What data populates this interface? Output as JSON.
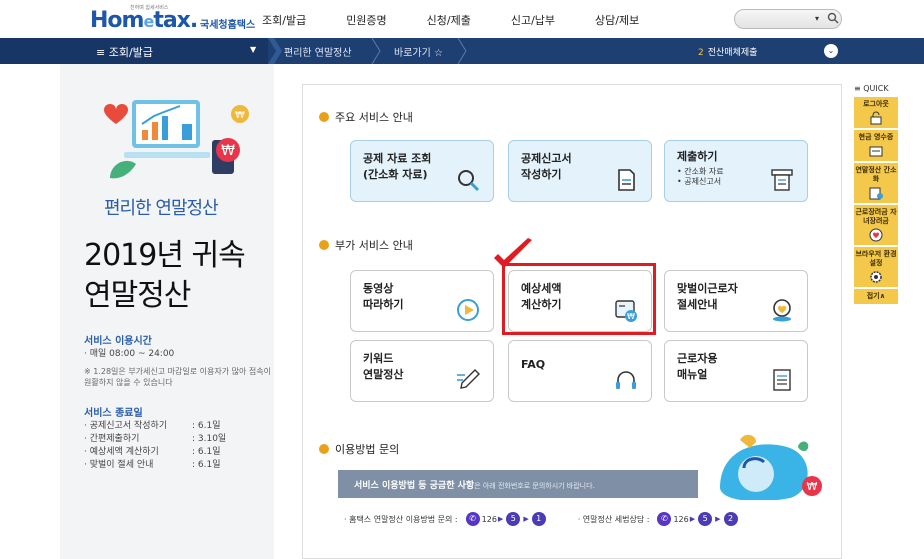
{
  "header": {
    "logo_tiny": "친하며 쉽세서비스",
    "logo_main_pre": "Hom",
    "logo_main_e": "e",
    "logo_main_post": "tax.",
    "logo_sub": "국세청홈택스",
    "nav": [
      "조회/발급",
      "민원증명",
      "신청/제출",
      "신고/납부",
      "상담/제보"
    ],
    "search_caret": "▾",
    "search_icon": "search-icon"
  },
  "navbar": {
    "menu_label": "≡ 조회/발급",
    "crumb1": "편리한 연말정산",
    "crumb2": "바로가기 ☆",
    "right_num": "2",
    "right_label": "전산매체제출",
    "chev": "⌄"
  },
  "left": {
    "subtitle": "편리한 연말정산",
    "title_line1": "2019년 귀속",
    "title_line2": "연말정산",
    "hours_heading": "서비스 이용시간",
    "hours_text": "· 매일 08:00 ~ 24:00",
    "note": "※ 1.28일은 부가세신고 마감일로 이용자가 많아 접속이 원활하지 않을 수 있습니다",
    "end_heading": "서비스 종료일",
    "end_items": [
      {
        "k": "· 공제신고서 작성하기",
        "v": ": 6.1일"
      },
      {
        "k": "· 간편제출하기",
        "v": ": 3.10일"
      },
      {
        "k": "· 예상세액 계산하기",
        "v": ": 6.1일"
      },
      {
        "k": "· 맞벌이 절세 안내",
        "v": ": 6.1일"
      }
    ]
  },
  "main": {
    "sec1": "주요 서비스 안내",
    "sec2": "부가 서비스 안내",
    "sec3": "이용방법 문의",
    "cards_main": [
      {
        "l1": "공제 자료 조회",
        "l2": "(간소화 자료)",
        "icon": "search-icon"
      },
      {
        "l1": "공제신고서",
        "l2": "작성하기",
        "icon": "document-icon"
      },
      {
        "l1": "제출하기",
        "b1": "• 간소화 자료",
        "b2": "• 공제신고서",
        "icon": "submit-icon"
      }
    ],
    "cards_extra": [
      {
        "l1": "동영상",
        "l2": "따라하기",
        "icon": "play-icon"
      },
      {
        "l1": "예상세액",
        "l2": "계산하기",
        "icon": "calculator-icon"
      },
      {
        "l1": "맞벌이근로자",
        "l2": "절세안내",
        "icon": "couple-icon"
      },
      {
        "l1": "키워드",
        "l2": "연말정산",
        "icon": "pencil-icon"
      },
      {
        "l1": "FAQ",
        "l2": "",
        "icon": "headset-icon"
      },
      {
        "l1": "근로자용",
        "l2": "매뉴얼",
        "icon": "manual-icon"
      }
    ],
    "banner_bold": "서비스 이용방법 등 궁금한 사항",
    "banner_rest": "은 아래 전화번호로 문의하시기 바랍니다.",
    "contact1": "· 홈택스 연말정산 이용방법 문의 :",
    "contact2": "· 연말정산 세법상담 :",
    "ph_num": "126",
    "step1": "5",
    "step2a": "1",
    "step2b": "2"
  },
  "quick": {
    "heading": "≡ QUICK",
    "items": [
      {
        "label": "로그아웃",
        "icon": "logout-icon"
      },
      {
        "label": "현금 영수증",
        "icon": "receipt-icon"
      },
      {
        "label": "연말정산 간소화",
        "icon": "simplify-icon"
      },
      {
        "label": "근로장려금 자녀장려금",
        "icon": "heart-icon"
      },
      {
        "label": "브라우저 환경설정",
        "icon": "gear-icon"
      },
      {
        "label": "접기∧",
        "icon": ""
      }
    ]
  },
  "colors": {
    "navbar": "#1e3f72",
    "accent_blue": "#2a5eab",
    "highlight_red": "#e01b22",
    "quick_yellow": "#f3c84b",
    "section_dot": "#e9a11a"
  }
}
